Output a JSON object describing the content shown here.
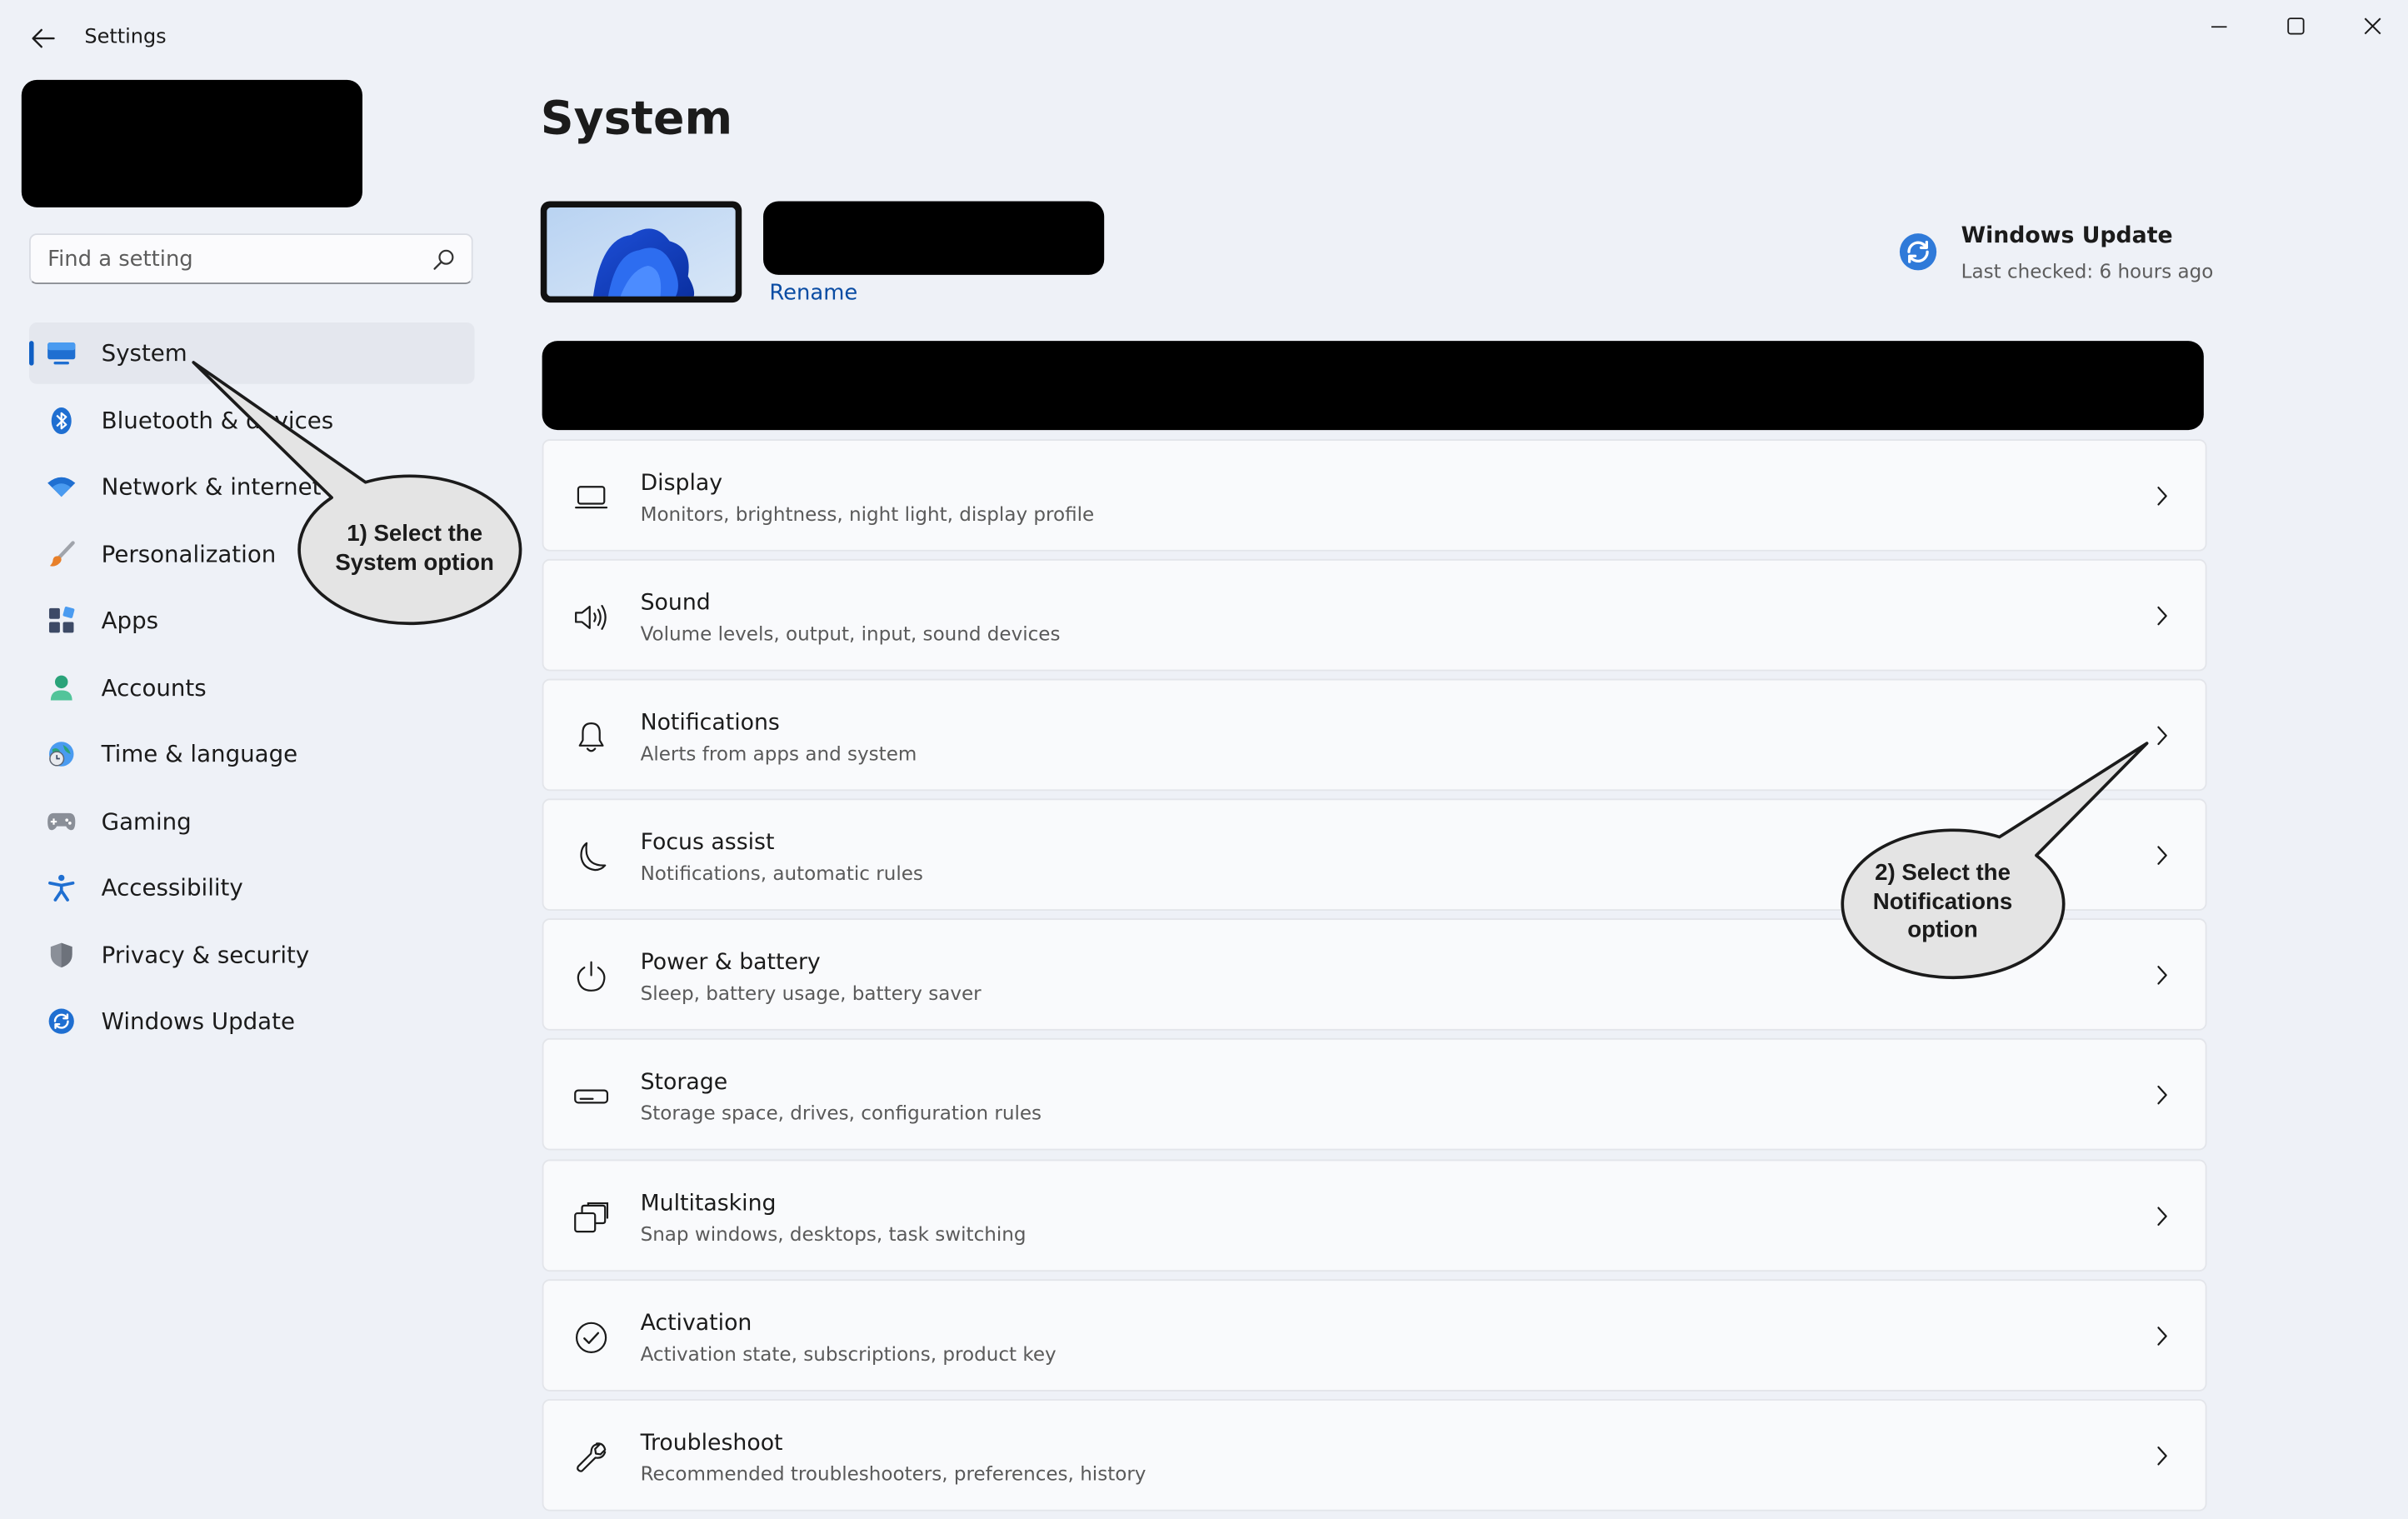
{
  "window": {
    "title": "Settings"
  },
  "search": {
    "placeholder": "Find a setting"
  },
  "sidebar": {
    "items": [
      {
        "label": "System",
        "icon": "system-icon",
        "active": true
      },
      {
        "label": "Bluetooth & devices",
        "icon": "bluetooth-icon",
        "active": false
      },
      {
        "label": "Network & internet",
        "icon": "wifi-icon",
        "active": false
      },
      {
        "label": "Personalization",
        "icon": "brush-icon",
        "active": false
      },
      {
        "label": "Apps",
        "icon": "apps-icon",
        "active": false
      },
      {
        "label": "Accounts",
        "icon": "person-icon",
        "active": false
      },
      {
        "label": "Time & language",
        "icon": "globe-clock-icon",
        "active": false
      },
      {
        "label": "Gaming",
        "icon": "gamepad-icon",
        "active": false
      },
      {
        "label": "Accessibility",
        "icon": "accessibility-icon",
        "active": false
      },
      {
        "label": "Privacy & security",
        "icon": "shield-icon",
        "active": false
      },
      {
        "label": "Windows Update",
        "icon": "update-icon",
        "active": false
      }
    ]
  },
  "main": {
    "title": "System",
    "rename_label": "Rename",
    "windows_update": {
      "title": "Windows Update",
      "status": "Last checked: 6 hours ago"
    },
    "cards": [
      {
        "title": "Display",
        "subtitle": "Monitors, brightness, night light, display profile",
        "icon": "monitor-icon"
      },
      {
        "title": "Sound",
        "subtitle": "Volume levels, output, input, sound devices",
        "icon": "speaker-icon"
      },
      {
        "title": "Notifications",
        "subtitle": "Alerts from apps and system",
        "icon": "bell-icon"
      },
      {
        "title": "Focus assist",
        "subtitle": "Notifications, automatic rules",
        "icon": "moon-icon"
      },
      {
        "title": "Power & battery",
        "subtitle": "Sleep, battery usage, battery saver",
        "icon": "power-icon"
      },
      {
        "title": "Storage",
        "subtitle": "Storage space, drives, configuration rules",
        "icon": "drive-icon"
      },
      {
        "title": "Multitasking",
        "subtitle": "Snap windows, desktops, task switching",
        "icon": "multitask-icon"
      },
      {
        "title": "Activation",
        "subtitle": "Activation state, subscriptions, product key",
        "icon": "check-circle-icon"
      },
      {
        "title": "Troubleshoot",
        "subtitle": "Recommended troubleshooters, preferences, history",
        "icon": "wrench-icon"
      }
    ]
  },
  "callouts": {
    "first": {
      "line1": "1) Select the",
      "line2": "System option"
    },
    "second": {
      "line1": "2) Select the",
      "line2": "Notifications",
      "line3": "option"
    }
  },
  "colors": {
    "accent": "#0f5fc4",
    "background": "#eef1f7",
    "card": "#f9fafc",
    "link": "#0a4ca3"
  }
}
